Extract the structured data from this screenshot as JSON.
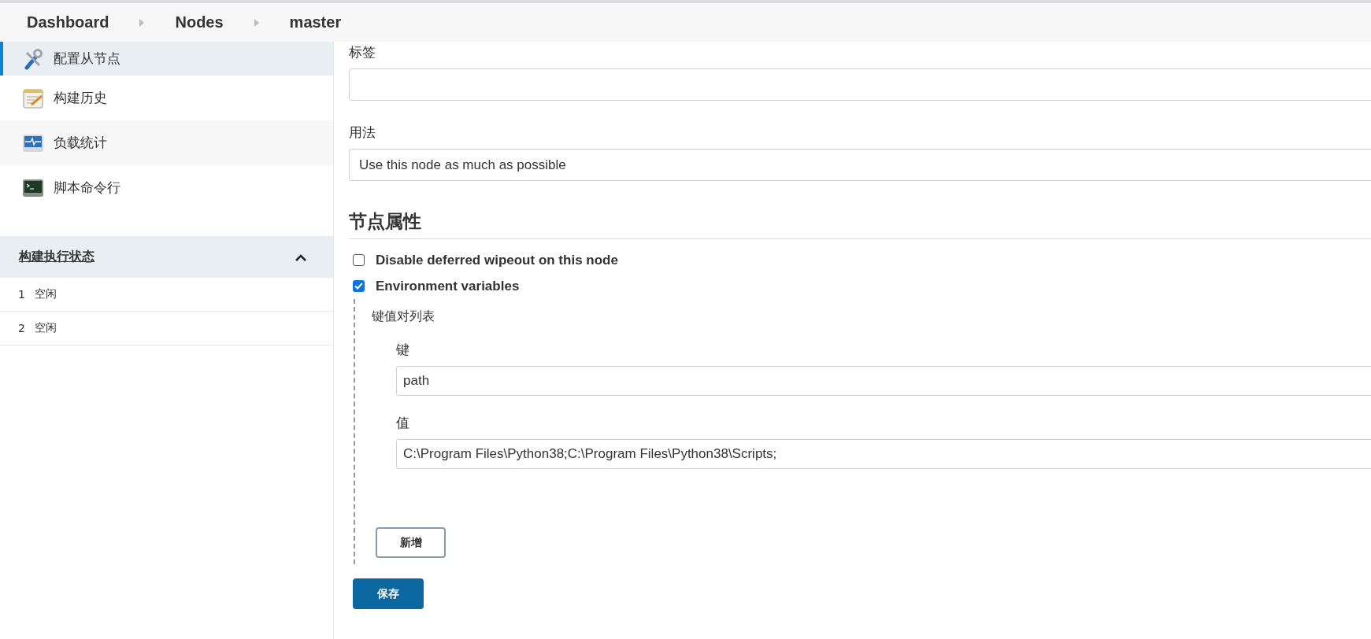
{
  "breadcrumbs": [
    "Dashboard",
    "Nodes",
    "master"
  ],
  "sidebar": {
    "items": [
      {
        "label": "配置从节点",
        "kind": "tools",
        "selected": true
      },
      {
        "label": "构建历史",
        "kind": "notepad",
        "selected": false
      },
      {
        "label": "负载统计",
        "kind": "monitor",
        "selected": false
      },
      {
        "label": "脚本命令行",
        "kind": "terminal",
        "selected": false
      }
    ]
  },
  "executors": {
    "title": "构建执行状态",
    "expanded": true,
    "rows": [
      {
        "number": "1",
        "status": "空闲"
      },
      {
        "number": "2",
        "status": "空闲"
      }
    ]
  },
  "form": {
    "labels_field": {
      "label": "标签"
    },
    "usage": {
      "label": "用法",
      "value": "Use this node as much as possible"
    },
    "section_title": "节点属性",
    "options": [
      {
        "label": "Disable deferred wipeout on this node",
        "checked": false
      },
      {
        "label": "Environment variables",
        "checked": true,
        "list_title": "键值对列表",
        "pairs": [
          {
            "key_label": "键",
            "key": "path",
            "value_label": "值",
            "value": "C:\\Program Files\\Python38;C:\\Program Files\\Python38\\Scripts;"
          }
        ],
        "add_button": "新增"
      }
    ],
    "save_button": "保存"
  }
}
